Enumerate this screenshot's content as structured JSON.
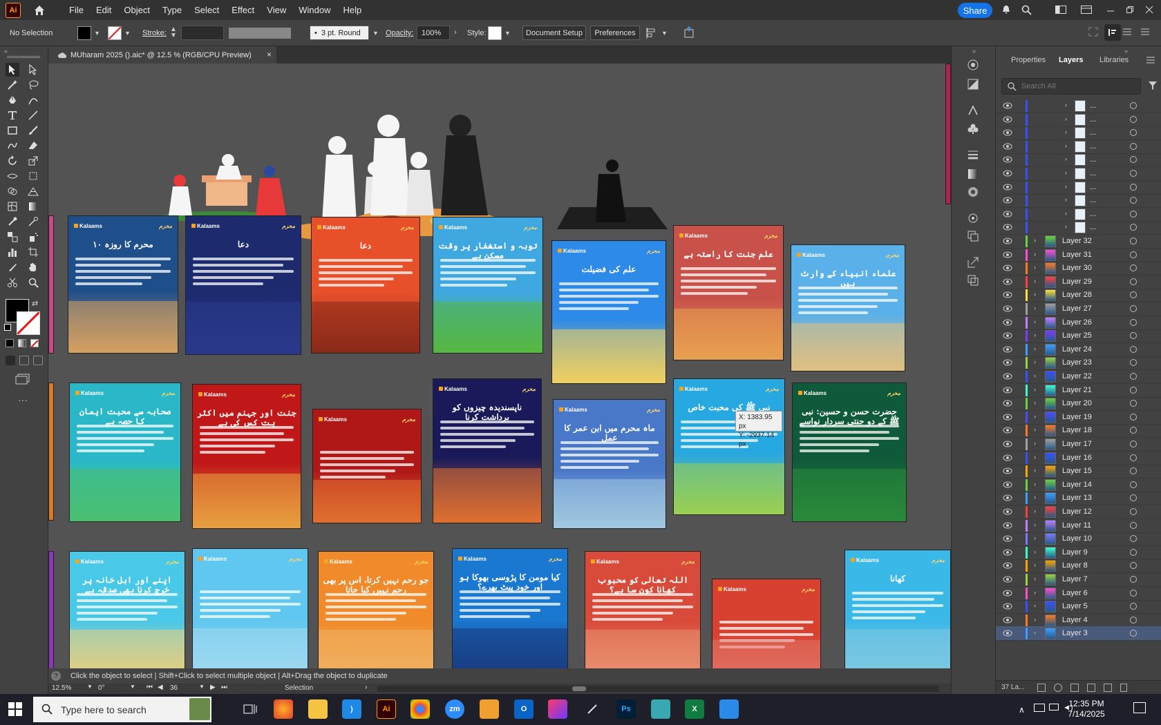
{
  "app": {
    "logo": "Ai",
    "menu": [
      "File",
      "Edit",
      "Object",
      "Type",
      "Select",
      "Effect",
      "View",
      "Window",
      "Help"
    ],
    "share_label": "Share"
  },
  "control": {
    "selection": "No Selection",
    "stroke_label": "Stroke:",
    "brush": "3 pt. Round",
    "opacity_label": "Opacity:",
    "opacity_value": "100%",
    "style_label": "Style:",
    "doc_setup": "Document Setup",
    "preferences": "Preferences"
  },
  "tab": {
    "title": "MUharam 2025 ().aic* @ 12.5 % (RGB/CPU Preview)",
    "close": "×"
  },
  "panel": {
    "tabs": [
      "Properties",
      "Layers",
      "Libraries"
    ],
    "search_placeholder": "Search All",
    "layers": [
      {
        "name": "...",
        "color": "#3a50ff",
        "sub": true
      },
      {
        "name": "...",
        "color": "#3a50ff",
        "sub": true
      },
      {
        "name": "...",
        "color": "#3a50ff",
        "sub": true
      },
      {
        "name": "...",
        "color": "#3a50ff",
        "sub": true
      },
      {
        "name": "...",
        "color": "#3a50ff",
        "sub": true
      },
      {
        "name": "...",
        "color": "#3a50ff",
        "sub": true
      },
      {
        "name": "...",
        "color": "#3a50ff",
        "sub": true
      },
      {
        "name": "...",
        "color": "#3a50ff",
        "sub": true
      },
      {
        "name": "...",
        "color": "#3a50ff",
        "sub": true
      },
      {
        "name": "...",
        "color": "#3a50ff",
        "sub": true
      },
      {
        "name": "Layer 32",
        "color": "#6ad43f"
      },
      {
        "name": "Layer 31",
        "color": "#ff4fd2"
      },
      {
        "name": "Layer 30",
        "color": "#ff7a22"
      },
      {
        "name": "Layer 29",
        "color": "#ff3d3d"
      },
      {
        "name": "Layer 28",
        "color": "#ffe23a"
      },
      {
        "name": "Layer 27",
        "color": "#a0a0a0"
      },
      {
        "name": "Layer 26",
        "color": "#c080ff"
      },
      {
        "name": "Layer 25",
        "color": "#7a3aff"
      },
      {
        "name": "Layer 24",
        "color": "#3aa0ff"
      },
      {
        "name": "Layer 23",
        "color": "#9ad43f"
      },
      {
        "name": "Layer 22",
        "color": "#3a50ff"
      },
      {
        "name": "Layer 21",
        "color": "#3affd0"
      },
      {
        "name": "Layer 20",
        "color": "#6ad43f"
      },
      {
        "name": "Layer 19",
        "color": "#4a4aff"
      },
      {
        "name": "Layer 18",
        "color": "#ff7a22"
      },
      {
        "name": "Layer 17",
        "color": "#a0a0a0"
      },
      {
        "name": "Layer 16",
        "color": "#3a50ff"
      },
      {
        "name": "Layer 15",
        "color": "#ffa500"
      },
      {
        "name": "Layer 14",
        "color": "#6ad43f"
      },
      {
        "name": "Layer 13",
        "color": "#3aa0ff"
      },
      {
        "name": "Layer 12",
        "color": "#ff3d3d"
      },
      {
        "name": "Layer 11",
        "color": "#c080ff"
      },
      {
        "name": "Layer 10",
        "color": "#7a7aff"
      },
      {
        "name": "Layer 9",
        "color": "#3affd0"
      },
      {
        "name": "Layer 8",
        "color": "#ffa500"
      },
      {
        "name": "Layer 7",
        "color": "#9ad43f"
      },
      {
        "name": "Layer 6",
        "color": "#ff4fd2"
      },
      {
        "name": "Layer 5",
        "color": "#3a50ff"
      },
      {
        "name": "Layer 4",
        "color": "#ff7a22"
      },
      {
        "name": "Layer 3",
        "color": "#3aa0ff"
      }
    ],
    "layer_count": "37 La..."
  },
  "status": {
    "hint": "Click the object to select  |  Shift+Click to select multiple object  |  Alt+Drag the object to duplicate",
    "zoom": "12.5%",
    "rotation": "0°",
    "artboard_num": "36",
    "tool": "Selection"
  },
  "coords": {
    "x": "X: 1383.95 px",
    "y": "Y: -2937.14 px"
  },
  "artboards": [
    {
      "title": "۱۰ محرم کا روزہ",
      "bg": "#1f4f8a",
      "ground": "#d6a060"
    },
    {
      "title": "دعا",
      "bg": "#1d2a6e",
      "ground": "#2a3a8a"
    },
    {
      "title": "دعا",
      "bg": "#e8502a",
      "ground": "#8a2a1a"
    },
    {
      "title": "توبہ و استغفار پر وقت مسکن ہے",
      "bg": "#3fa8e0",
      "ground": "#56b840"
    },
    {
      "title": "علم کی فضیلت",
      "bg": "#2d8ae8",
      "ground": "#f0d060"
    },
    {
      "title": "علم جنت کا راستہ ہے",
      "bg": "#c8524a",
      "ground": "#e8a050"
    },
    {
      "title": "علماء انبیاء کے وارث ہیں",
      "bg": "#5ab0e8",
      "ground": "#e0c080"
    },
    {
      "title": "صحابہ سے محبت ایمان کا حصہ ہے",
      "bg": "#2ab8c8",
      "ground": "#4ac070"
    },
    {
      "title": "جنت اور جہنم میں اکثر یت کس کی ہے",
      "bg": "#c01818",
      "ground": "#e8a040"
    },
    {
      "title": "",
      "bg": "#b01818",
      "ground": "#e07030"
    },
    {
      "title": "ناپسندیدہ چیزوں کو برداشت کرنا",
      "bg": "#1a1a5a",
      "ground": "#e07030"
    },
    {
      "title": "ماہ محرم میں ابن عمر کا عمل",
      "bg": "#4a78c8",
      "ground": "#a0c8e0"
    },
    {
      "title": "نبی ﷺ کی محبت خاص",
      "bg": "#28a8e0",
      "ground": "#9ad050"
    },
    {
      "title": "حضرت حسن و حسین: نبی ﷺ کے دو جنتی سردار نواسے",
      "bg": "#0f5a3a",
      "ground": "#2a8a3a"
    },
    {
      "title": "اپنے اور اہل خانہ پر خرچ کرنا بھی صدقہ ہے",
      "bg": "#4ac8e8",
      "ground": "#e8d080"
    },
    {
      "title": "",
      "bg": "#60c8f0",
      "ground": "#a0d8f0"
    },
    {
      "title": "جو رحم نہیں کرتا، اس پر بھی رحم نہیں کیا جاتا",
      "bg": "#f08a2a",
      "ground": "#f0b060"
    },
    {
      "title": "کیا مومن کا پڑوسی بھوکا ہو اور خود پیٹ بھرے؟",
      "bg": "#1a78d0",
      "ground": "#1a3a80"
    },
    {
      "title": "اللہ تعالی کو محبوب کھانا کون سا ہے؟",
      "bg": "#d84a3a",
      "ground": "#e89070"
    },
    {
      "title": "",
      "bg": "#d84030",
      "ground": "#e07060"
    },
    {
      "title": "کھانا",
      "bg": "#3ab8e8",
      "ground": "#80c8e0"
    }
  ],
  "brand": {
    "logo": "Kalaams",
    "badge": "محرم"
  },
  "taskbar": {
    "search_placeholder": "Type here to search",
    "time": "12:35 PM",
    "date": "7/14/2025",
    "apps": [
      "firefox",
      "files",
      "vscode",
      "illustrator",
      "chrome",
      "zoom",
      "bitwarden",
      "outlook",
      "creative-cloud",
      "pen",
      "photoshop",
      "app",
      "excel",
      "paint"
    ]
  },
  "colors": {
    "accent": "#1473e6",
    "ai_orange": "#ff9a00"
  }
}
